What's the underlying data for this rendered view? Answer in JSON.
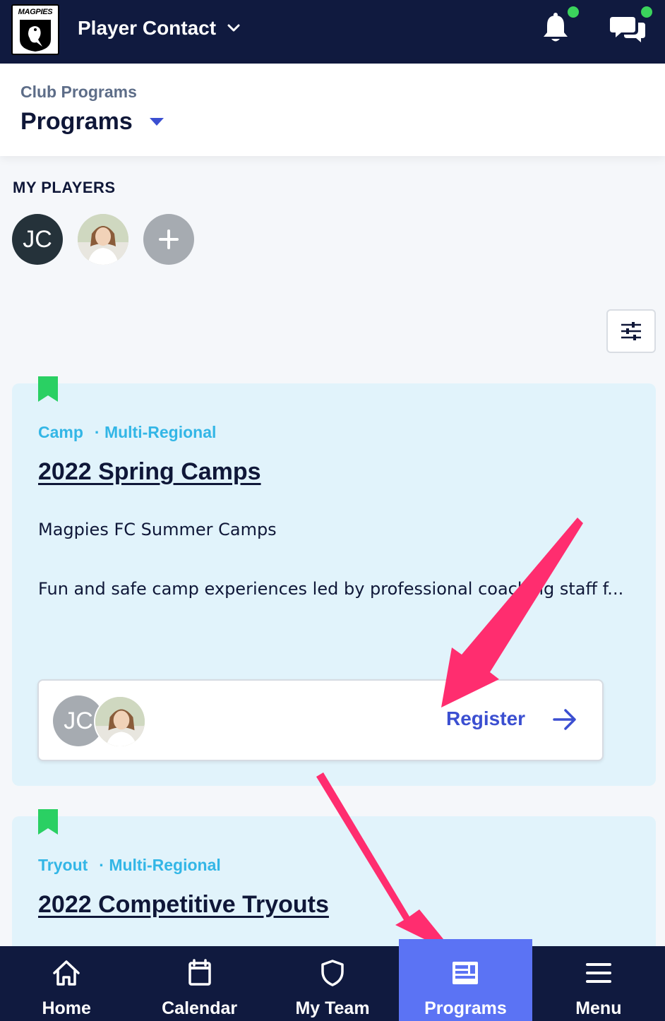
{
  "topbar": {
    "logo_text": "MAGPIES",
    "title": "Player Contact",
    "colors": {
      "background": "#101a3f",
      "notification_dot": "#3bd45c"
    }
  },
  "header": {
    "breadcrumb": "Club Programs",
    "title": "Programs"
  },
  "my_players": {
    "label": "MY PLAYERS",
    "players": [
      {
        "initials": "JC"
      },
      {
        "initials": "",
        "photo": true
      }
    ],
    "add_icon": "plus-icon"
  },
  "programs": [
    {
      "tags": [
        "Camp",
        "· Multi-Regional"
      ],
      "title": "2022 Spring Camps",
      "description_line1": "Magpies FC Summer Camps",
      "description_line2": "Fun and safe camp experiences led by professional coaching staff f...",
      "register": {
        "avatar_initials": "JC",
        "label": "Register"
      }
    },
    {
      "tags": [
        "Tryout",
        "· Multi-Regional"
      ],
      "title": "2022 Competitive Tryouts"
    }
  ],
  "bottom_nav": {
    "items": [
      {
        "label": "Home",
        "icon": "home-icon"
      },
      {
        "label": "Calendar",
        "icon": "calendar-icon"
      },
      {
        "label": "My Team",
        "icon": "shield-icon"
      },
      {
        "label": "Programs",
        "icon": "programs-icon",
        "active": true
      },
      {
        "label": "Menu",
        "icon": "menu-icon"
      }
    ],
    "active_color": "#5b73f4"
  }
}
